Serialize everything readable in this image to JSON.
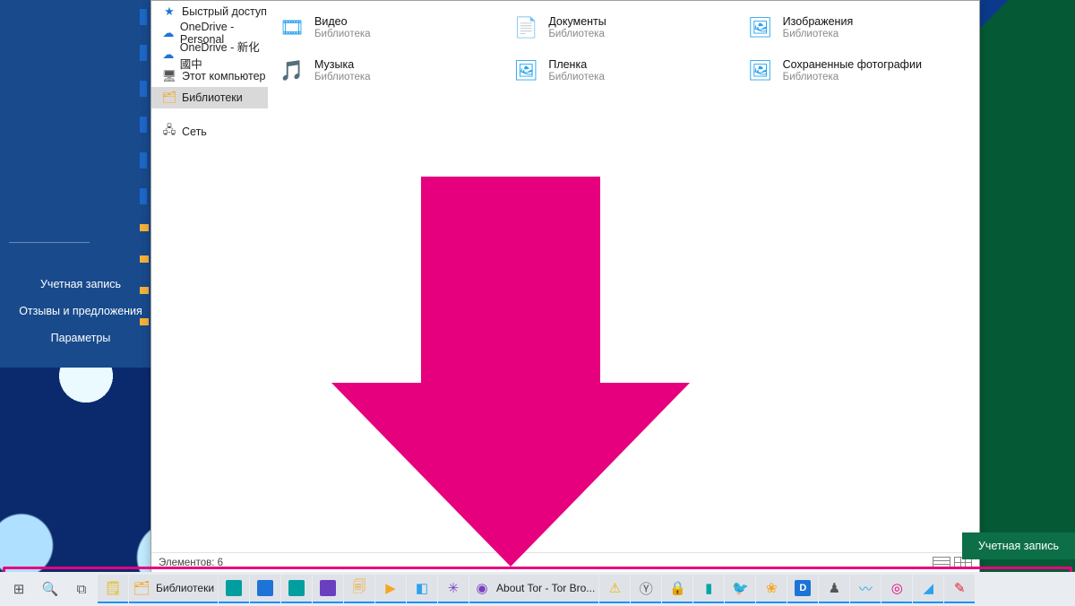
{
  "start_menu": {
    "items": [
      "Учетная запись",
      "Отзывы и предложения",
      "Параметры"
    ]
  },
  "explorer": {
    "nav": [
      {
        "label": "Быстрый доступ",
        "icon": "★",
        "cls": "c-blue"
      },
      {
        "label": "OneDrive - Personal",
        "icon": "☁",
        "cls": "c-blue"
      },
      {
        "label": "OneDrive - 新化國中",
        "icon": "☁",
        "cls": "c-blue"
      },
      {
        "label": "Этот компьютер",
        "icon": "🖥",
        "cls": "c-gray"
      },
      {
        "label": "Библиотеки",
        "icon": "🗂",
        "cls": "c-orange",
        "selected": true
      },
      {
        "spacer": true
      },
      {
        "label": "Сеть",
        "icon": "🖧",
        "cls": "c-gray"
      }
    ],
    "libs": [
      {
        "title": "Видео",
        "sub": "Библиотека",
        "glyph": "🎞",
        "cls": "c-sky"
      },
      {
        "title": "Документы",
        "sub": "Библиотека",
        "glyph": "📄",
        "cls": "c-sky"
      },
      {
        "title": "Изображения",
        "sub": "Библиотека",
        "glyph": "🖼",
        "cls": "c-sky"
      },
      {
        "title": "Музыка",
        "sub": "Библиотека",
        "glyph": "🎵",
        "cls": "c-sky"
      },
      {
        "title": "Пленка",
        "sub": "Библиотека",
        "glyph": "🖼",
        "cls": "c-sky"
      },
      {
        "title": "Сохраненные фотографии",
        "sub": "Библиотека",
        "glyph": "🖼",
        "cls": "c-sky"
      }
    ],
    "status": "Элементов: 6"
  },
  "account_button": "Учетная запись",
  "taskbar": [
    {
      "name": "start",
      "glyph": "⊞",
      "cls": "c-gray"
    },
    {
      "name": "search",
      "glyph": "🔍",
      "cls": "c-gray"
    },
    {
      "name": "task-view",
      "glyph": "⧉",
      "cls": "c-gray"
    },
    {
      "name": "sticky-notes",
      "glyph": "🗒",
      "cls": "c-yellow",
      "running": true
    },
    {
      "name": "explorer",
      "glyph": "🗂",
      "cls": "c-orange",
      "label": "Библиотеки",
      "running": true
    },
    {
      "name": "app-1",
      "glyph": "▦",
      "cls": "",
      "sq": "bg-teal",
      "running": true
    },
    {
      "name": "app-2",
      "glyph": "▦",
      "cls": "",
      "sq": "bg-blue",
      "running": true
    },
    {
      "name": "app-3",
      "glyph": "▦",
      "cls": "",
      "sq": "bg-teal",
      "running": true
    },
    {
      "name": "app-4",
      "glyph": "▦",
      "cls": "",
      "sq": "bg-purple",
      "running": true
    },
    {
      "name": "app-5",
      "glyph": "🗐",
      "cls": "c-orange",
      "running": true
    },
    {
      "name": "media",
      "glyph": "▶",
      "cls": "c-orange",
      "running": true
    },
    {
      "name": "app-6",
      "glyph": "◧",
      "cls": "c-sky",
      "running": true
    },
    {
      "name": "app-7",
      "glyph": "✳",
      "cls": "c-purple",
      "running": true
    },
    {
      "name": "tor",
      "glyph": "◉",
      "cls": "c-purple",
      "label": "About Tor - Tor Bro...",
      "running": true
    },
    {
      "name": "warning",
      "glyph": "⚠",
      "cls": "c-yellow",
      "running": true
    },
    {
      "name": "yandex",
      "glyph": "Ⓨ",
      "cls": "c-gray",
      "running": true
    },
    {
      "name": "lock-app",
      "glyph": "🔒",
      "cls": "c-gray",
      "running": true
    },
    {
      "name": "app-8",
      "glyph": "▮",
      "cls": "c-teal",
      "running": true
    },
    {
      "name": "hummingbird",
      "glyph": "🐦",
      "cls": "c-green",
      "running": true
    },
    {
      "name": "brain",
      "glyph": "❀",
      "cls": "c-orange",
      "running": true
    },
    {
      "name": "app-d",
      "glyph": "D",
      "cls": "",
      "sq": "bg-blue",
      "running": true
    },
    {
      "name": "app-9",
      "glyph": "♟",
      "cls": "c-gray",
      "running": true
    },
    {
      "name": "app-10",
      "glyph": "〰",
      "cls": "c-sky",
      "running": true
    },
    {
      "name": "instagram",
      "glyph": "◎",
      "cls": "c-pink",
      "running": true
    },
    {
      "name": "app-11",
      "glyph": "◢",
      "cls": "c-sky",
      "running": true
    },
    {
      "name": "app-12",
      "glyph": "✎",
      "cls": "c-red",
      "running": true
    }
  ]
}
